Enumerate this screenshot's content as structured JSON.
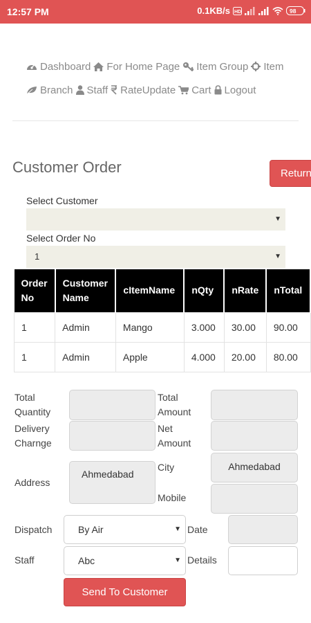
{
  "status_bar": {
    "time": "12:57 PM",
    "network_speed": "0.1KB/s",
    "battery": "98"
  },
  "nav": {
    "row1": [
      {
        "icon": "tachometer-icon",
        "label": "Dashboard"
      },
      {
        "icon": "home-icon",
        "label": "For Home Page"
      },
      {
        "icon": "key-icon",
        "label": "Item Group"
      },
      {
        "icon": "crosshair-icon",
        "label": "Item"
      }
    ],
    "row2": [
      {
        "icon": "leaf-icon",
        "label": "Branch"
      },
      {
        "icon": "user-icon",
        "label": "Staff"
      },
      {
        "icon": "rupee-icon",
        "label": "RateUpdate"
      },
      {
        "icon": "cart-icon",
        "label": "Cart"
      },
      {
        "icon": "lock-icon",
        "label": "Logout"
      }
    ]
  },
  "page": {
    "title": "Customer Order",
    "return_label": "Return"
  },
  "filters": {
    "customer_label": "Select Customer",
    "customer_value": "",
    "order_label": "Select Order No",
    "order_value": "1"
  },
  "orders_table": {
    "headers": [
      "Order No",
      "Customer Name",
      "cItemName",
      "nQty",
      "nRate",
      "nTotal"
    ],
    "rows": [
      [
        "1",
        "Admin",
        "Mango",
        "3.000",
        "30.00",
        "90.00"
      ],
      [
        "1",
        "Admin",
        "Apple",
        "4.000",
        "20.00",
        "80.00"
      ]
    ]
  },
  "form": {
    "total_quantity_label": "Total Quantity",
    "total_quantity_value": "",
    "total_amount_label": "Total Amount",
    "total_amount_value": "",
    "delivery_charge_label": "Delivery Charnge",
    "delivery_charge_value": "",
    "net_amount_label": "Net Amount",
    "net_amount_value": "",
    "address_label": "Address",
    "address_value": "Ahmedabad",
    "city_label": "City",
    "city_value": "Ahmedabad",
    "mobile_label": "Mobile",
    "mobile_value": "",
    "dispatch_label": "Dispatch",
    "dispatch_value": "By Air",
    "date_label": "Date",
    "date_value": "",
    "staff_label": "Staff",
    "staff_value": "Abc",
    "details_label": "Details",
    "details_value": "",
    "send_label": "Send To Customer"
  },
  "colors": {
    "accent": "#e05454",
    "table_header_bg": "#000000",
    "input_bg": "#ececec"
  }
}
